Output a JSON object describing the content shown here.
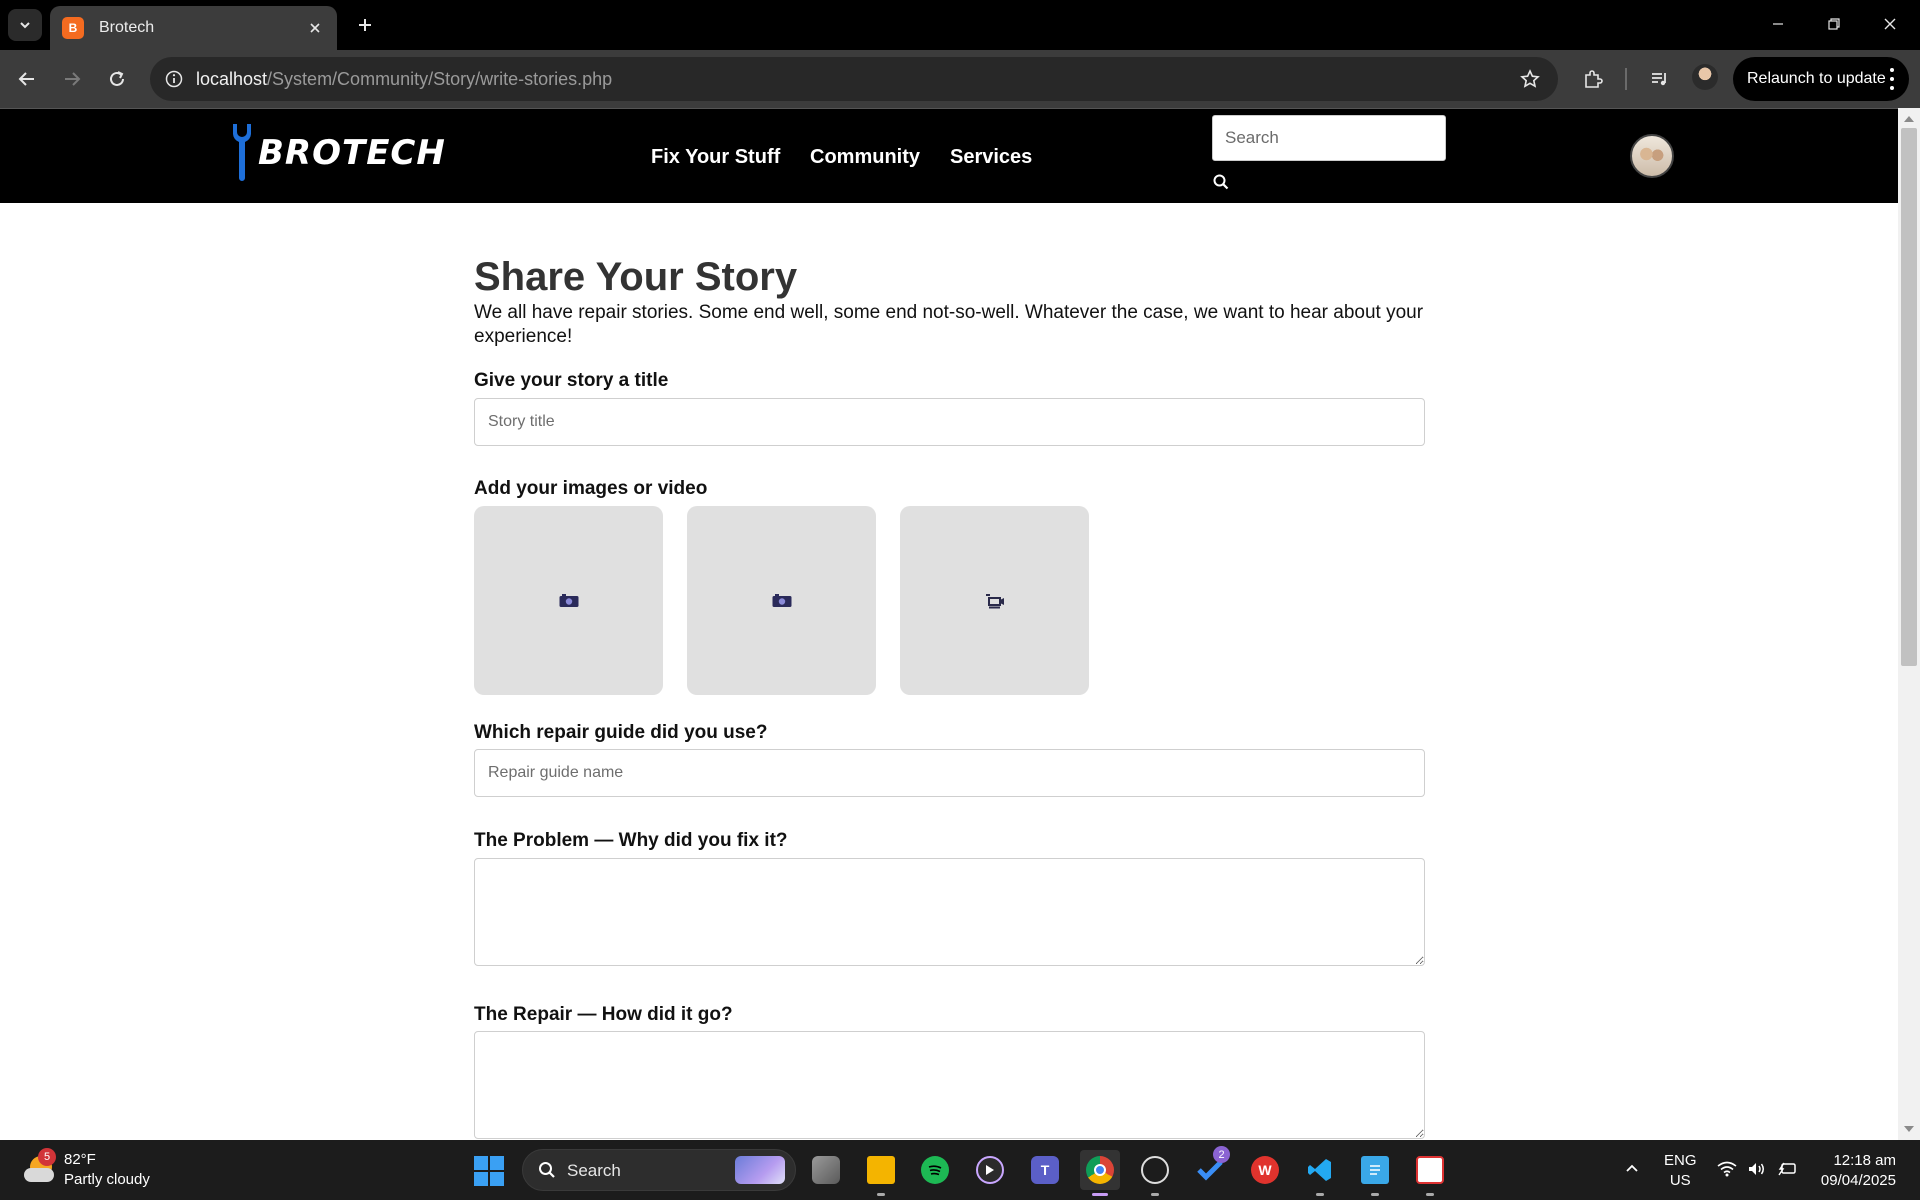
{
  "browser": {
    "tab_title": "Brotech",
    "tab_favicon_letter": "B",
    "url_host": "localhost",
    "url_path": "/System/Community/Story/write-stories.php",
    "relaunch_label": "Relaunch to update"
  },
  "site": {
    "logo_text": "BROTECH",
    "nav": [
      "Fix Your Stuff",
      "Community",
      "Services"
    ],
    "search_placeholder": "Search"
  },
  "form": {
    "title": "Share Your Story",
    "intro": "We all have repair stories. Some end well, some end not-so-well. Whatever the case, we want to hear about your experience!",
    "story_title_label": "Give your story a title",
    "story_title_placeholder": "Story title",
    "media_label": "Add your images or video",
    "media_slots": [
      "image-upload-icon",
      "image-upload-icon",
      "video-upload-icon"
    ],
    "guide_label": "Which repair guide did you use?",
    "guide_placeholder": "Repair guide name",
    "problem_label": "The Problem — Why did you fix it?",
    "repair_label": "The Repair — How did it go?"
  },
  "taskbar": {
    "weather_temp": "82°F",
    "weather_desc": "Partly cloudy",
    "weather_badge": "5",
    "search_label": "Search",
    "todo_badge": "2",
    "lang_top": "ENG",
    "lang_bottom": "US",
    "time": "12:18 am",
    "date": "09/04/2025"
  },
  "colors": {
    "brand_accent": "#1e6fd9",
    "header_bg": "#000000",
    "media_box_bg": "#e0e0e0"
  }
}
